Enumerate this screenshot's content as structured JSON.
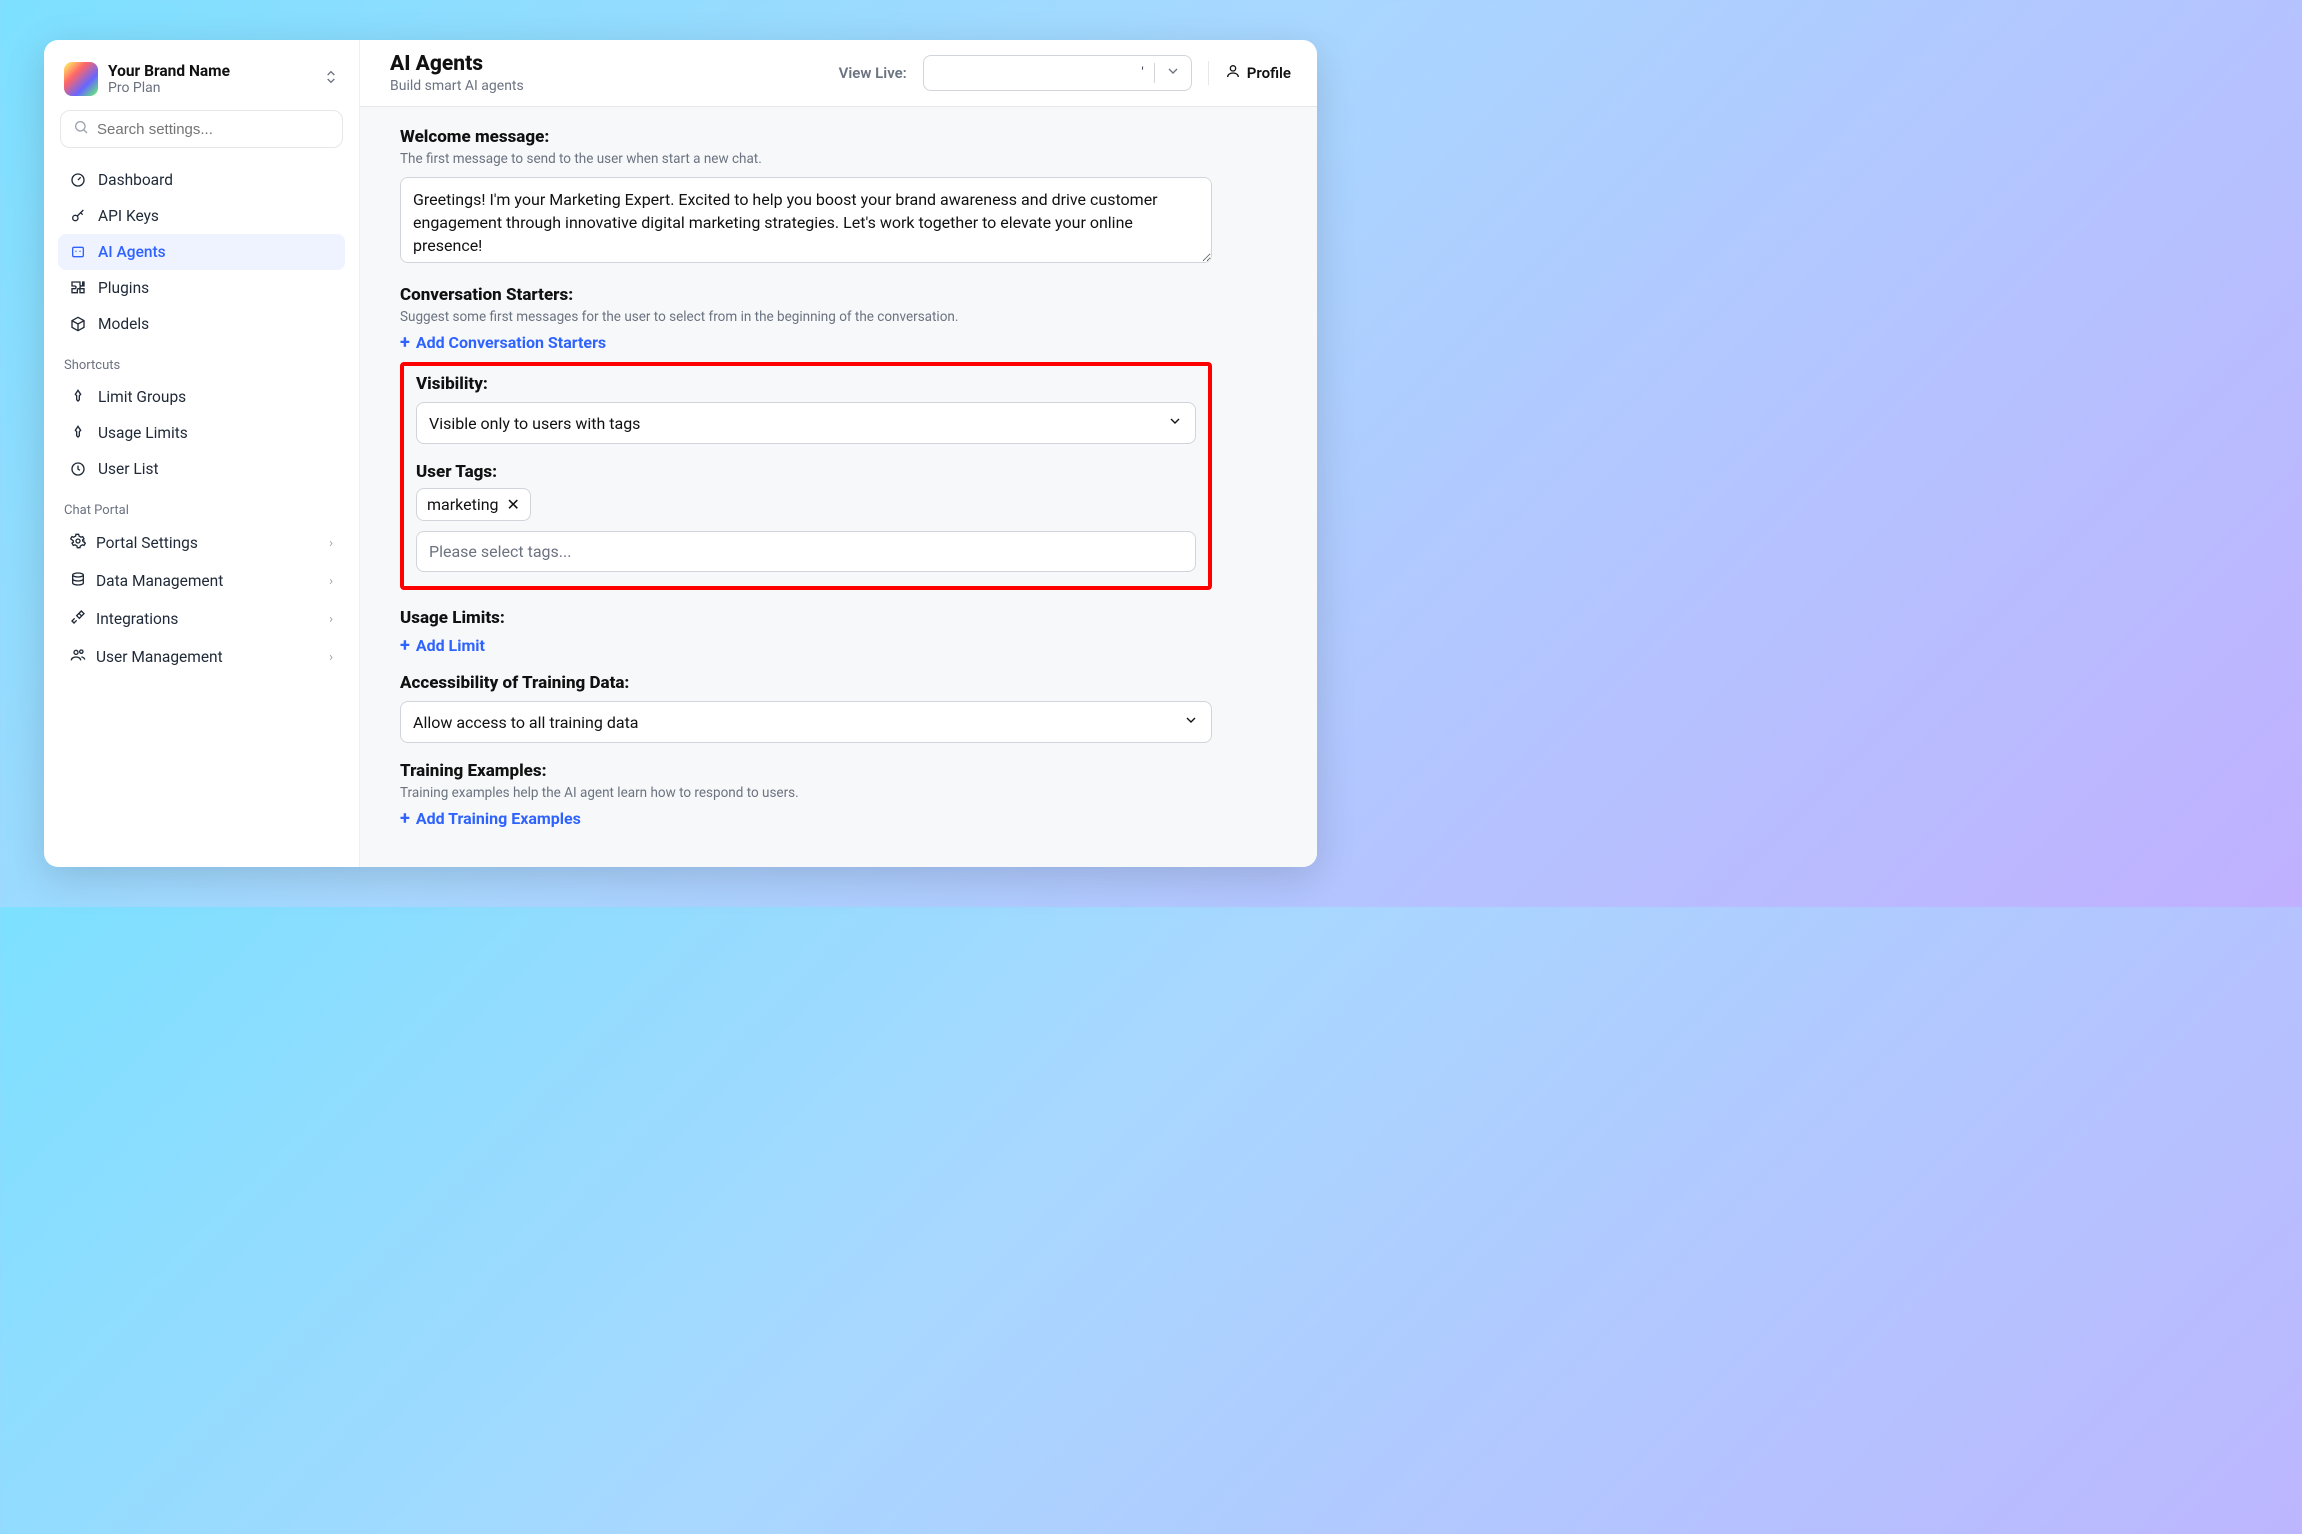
{
  "brand": {
    "name": "Your Brand Name",
    "plan": "Pro Plan"
  },
  "search": {
    "placeholder": "Search settings..."
  },
  "nav": {
    "items": [
      {
        "label": "Dashboard"
      },
      {
        "label": "API Keys"
      },
      {
        "label": "AI Agents"
      },
      {
        "label": "Plugins"
      },
      {
        "label": "Models"
      }
    ],
    "shortcuts_label": "Shortcuts",
    "shortcuts": [
      {
        "label": "Limit Groups"
      },
      {
        "label": "Usage Limits"
      },
      {
        "label": "User List"
      }
    ],
    "chat_portal_label": "Chat Portal",
    "chat_portal": [
      {
        "label": "Portal Settings"
      },
      {
        "label": "Data Management"
      },
      {
        "label": "Integrations"
      },
      {
        "label": "User Management"
      }
    ]
  },
  "header": {
    "title": "AI Agents",
    "subtitle": "Build smart AI agents",
    "view_live_label": "View Live:",
    "view_live_value": "'",
    "profile_label": "Profile"
  },
  "form": {
    "welcome": {
      "title": "Welcome message:",
      "desc": "The first message to send to the user when start a new chat.",
      "value": "Greetings! I'm your Marketing Expert. Excited to help you boost your brand awareness and drive customer engagement through innovative digital marketing strategies. Let's work together to elevate your online presence!"
    },
    "conv_starters": {
      "title": "Conversation Starters:",
      "desc": "Suggest some first messages for the user to select from in the beginning of the conversation.",
      "add_label": "Add Conversation Starters"
    },
    "visibility": {
      "title": "Visibility:",
      "selected": "Visible only to users with tags"
    },
    "user_tags": {
      "title": "User Tags:",
      "tags": [
        "marketing"
      ],
      "placeholder": "Please select tags..."
    },
    "usage_limits": {
      "title": "Usage Limits:",
      "add_label": "Add Limit"
    },
    "training_access": {
      "title": "Accessibility of Training Data:",
      "selected": "Allow access to all training data"
    },
    "training_examples": {
      "title": "Training Examples:",
      "desc": "Training examples help the AI agent learn how to respond to users.",
      "add_label": "Add Training Examples"
    }
  }
}
